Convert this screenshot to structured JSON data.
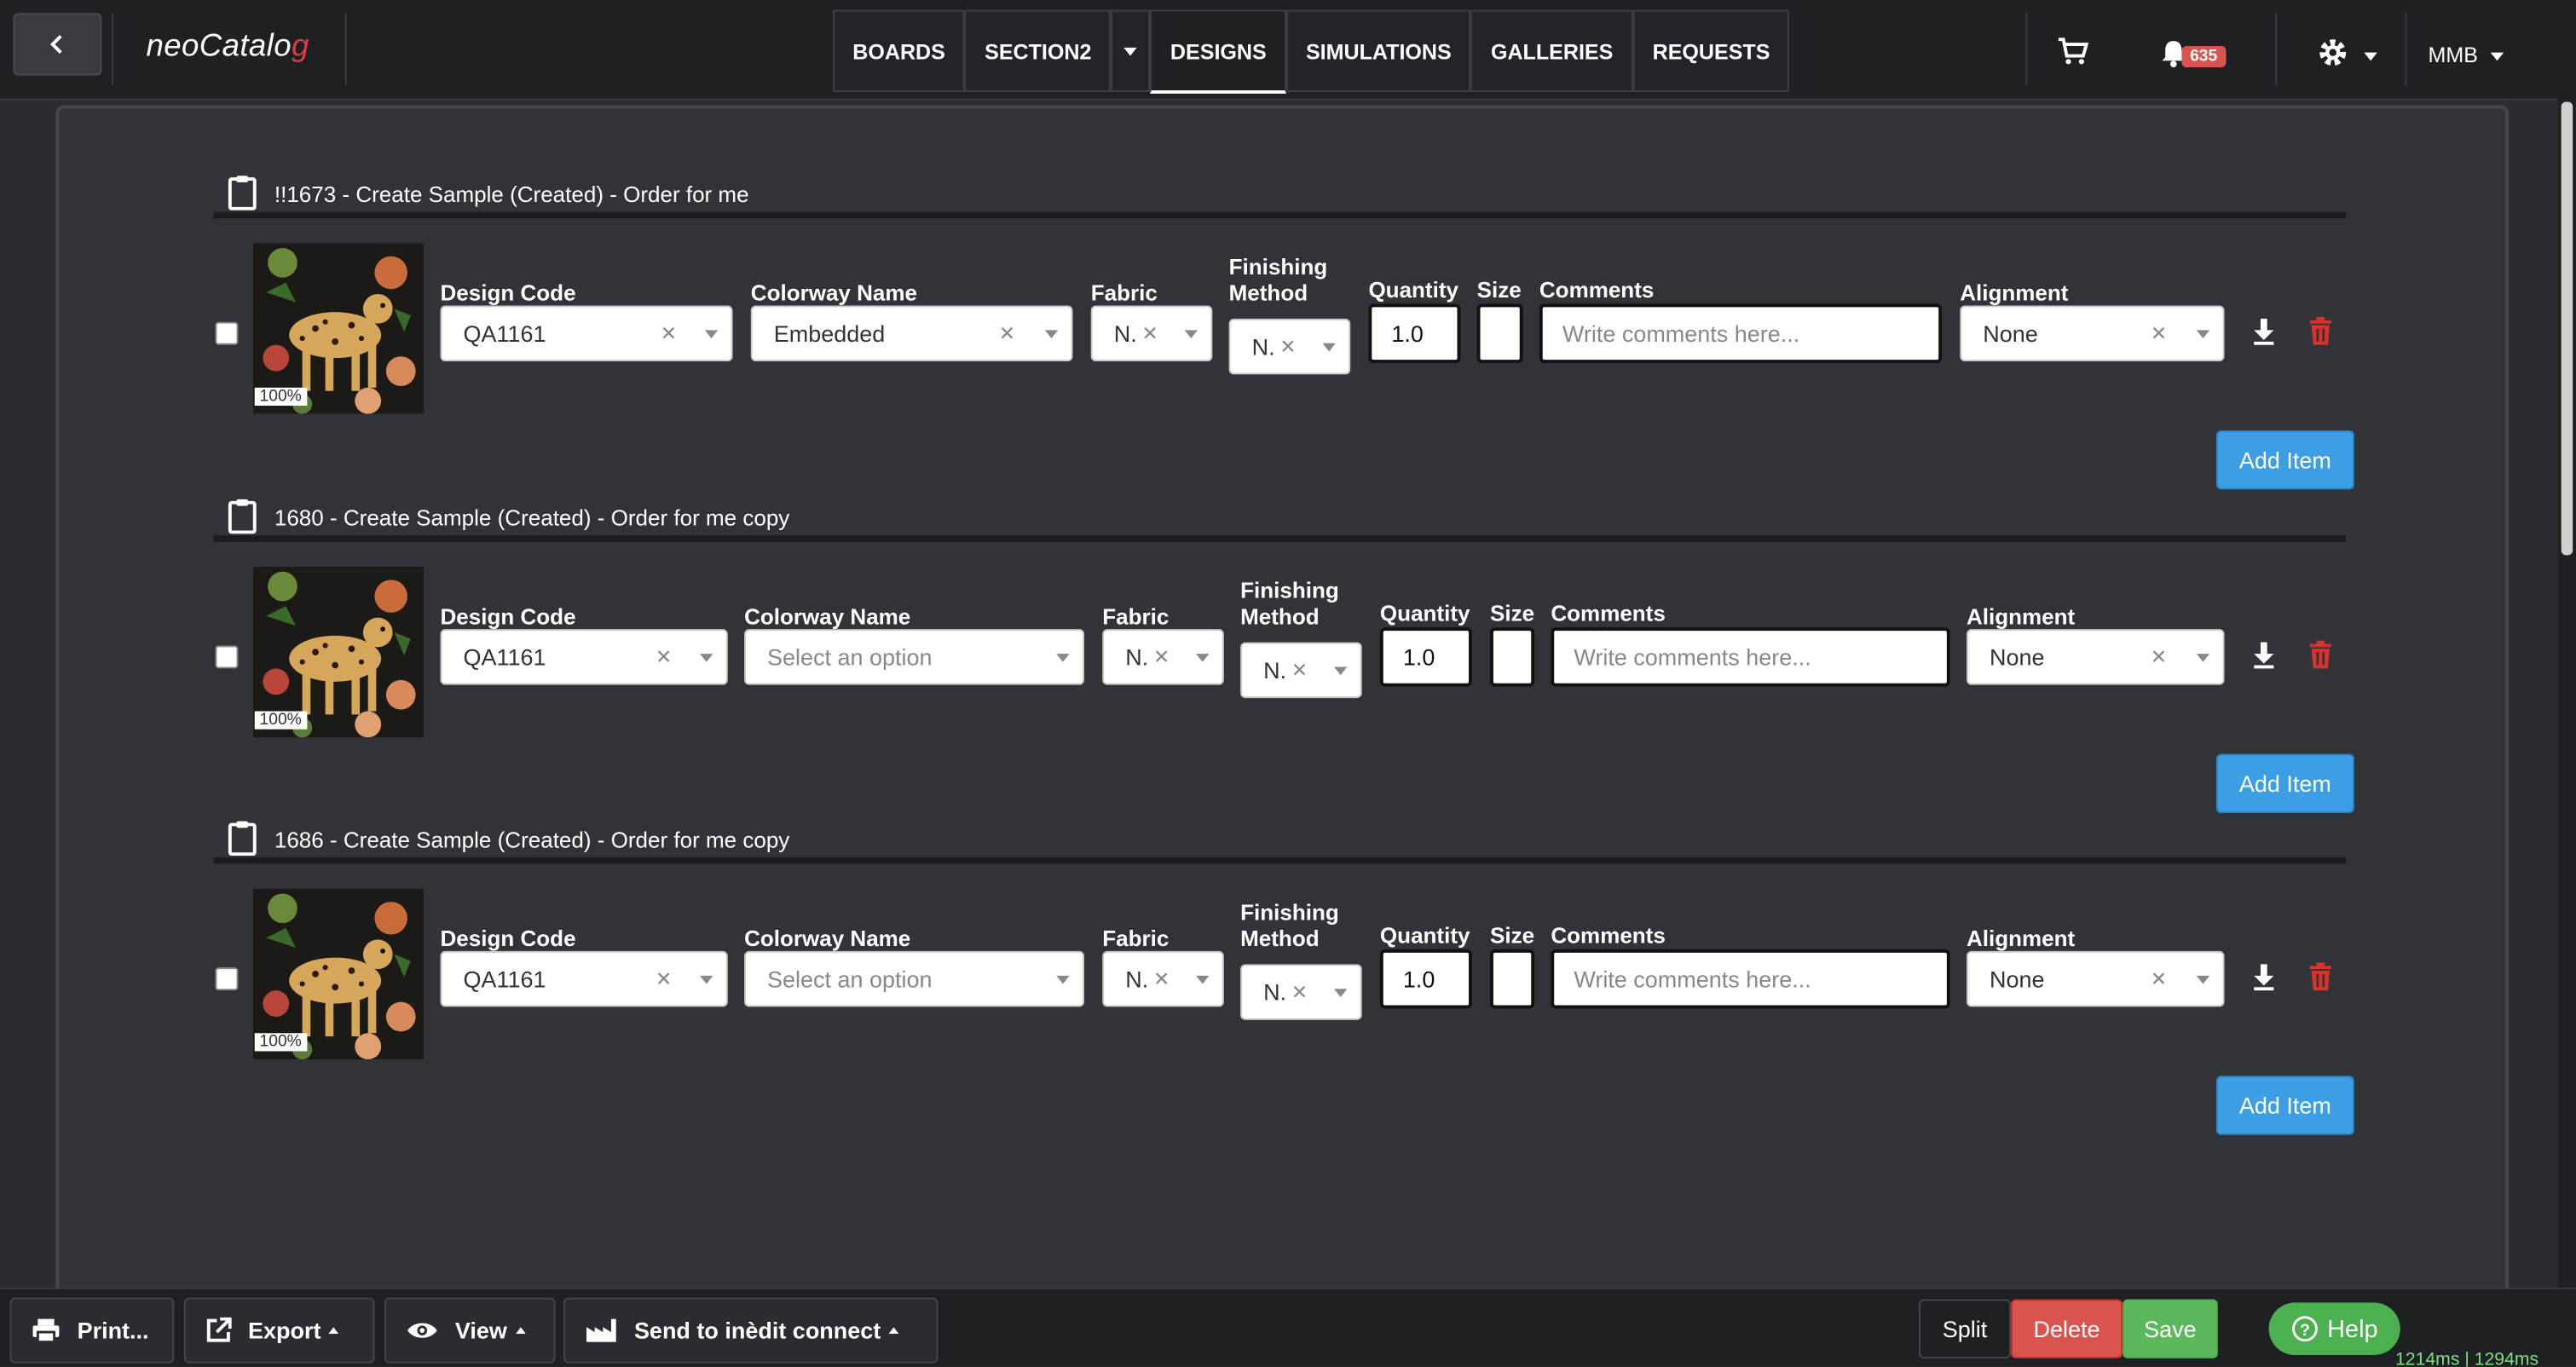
{
  "app": {
    "logo": "neoCatalo",
    "logo_mark": "g"
  },
  "nav": {
    "items": [
      "BOARDS",
      "SECTION2",
      "DESIGNS",
      "SIMULATIONS",
      "GALLERIES",
      "REQUESTS"
    ],
    "active": "DESIGNS"
  },
  "header": {
    "notifications_count": "635",
    "user": "MMB"
  },
  "sections": [
    {
      "title": "!!1673 - Create Sample (Created) - Order for me",
      "thumb_zoom": "100%",
      "labels": {
        "design_code": "Design Code",
        "colorway": "Colorway Name",
        "fabric": "Fabric",
        "finishing": "Finishing Method",
        "quantity": "Quantity",
        "size": "Size",
        "comments": "Comments",
        "alignment": "Alignment"
      },
      "design_code": "QA1161",
      "colorway": "Embedded",
      "colorway_placeholder": "",
      "fabric": "N.",
      "finishing": "N.",
      "quantity": "1.0",
      "size": "",
      "comments_placeholder": "Write comments here...",
      "alignment": "None",
      "add_label": "Add Item"
    },
    {
      "title": "1680 - Create Sample (Created) - Order for me copy",
      "thumb_zoom": "100%",
      "labels": {
        "design_code": "Design Code",
        "colorway": "Colorway Name",
        "fabric": "Fabric",
        "finishing": "Finishing Method",
        "quantity": "Quantity",
        "size": "Size",
        "comments": "Comments",
        "alignment": "Alignment"
      },
      "design_code": "QA1161",
      "colorway": "",
      "colorway_placeholder": "Select an option",
      "fabric": "N.",
      "finishing": "N.",
      "quantity": "1.0",
      "size": "",
      "comments_placeholder": "Write comments here...",
      "alignment": "None",
      "add_label": "Add Item"
    },
    {
      "title": "1686 - Create Sample (Created) - Order for me copy",
      "thumb_zoom": "100%",
      "labels": {
        "design_code": "Design Code",
        "colorway": "Colorway Name",
        "fabric": "Fabric",
        "finishing": "Finishing Method",
        "quantity": "Quantity",
        "size": "Size",
        "comments": "Comments",
        "alignment": "Alignment"
      },
      "design_code": "QA1161",
      "colorway": "",
      "colorway_placeholder": "Select an option",
      "fabric": "N.",
      "finishing": "N.",
      "quantity": "1.0",
      "size": "",
      "comments_placeholder": "Write comments here...",
      "alignment": "None",
      "add_label": "Add Item"
    }
  ],
  "footer": {
    "print": "Print...",
    "export": "Export",
    "view": "View",
    "send": "Send to inèdit connect",
    "split": "Split",
    "delete": "Delete",
    "save": "Save",
    "help": "Help",
    "timing": "1214ms | 1294ms"
  },
  "colors": {
    "accent": "#3c9ee5",
    "delete": "#d9534f",
    "save": "#5cb85c",
    "help": "#4caf50",
    "trash_icon": "#d9322b"
  }
}
